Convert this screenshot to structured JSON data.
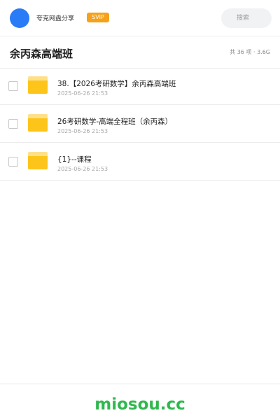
{
  "header": {
    "share_name": "夸克网盘分享",
    "badge": "SVIP",
    "search_placeholder": "搜索",
    "avatar_color": "#2a7bf6",
    "badge_color": "#f5a11b"
  },
  "folder": {
    "title": "余丙森高端班",
    "summary": "共 36 项 · 3.6G"
  },
  "items": [
    {
      "name": "38.【2026考研数学】余丙森高端班",
      "date": "2025-06-26 21:53",
      "icon": "folder-icon"
    },
    {
      "name": "26考研数学-高端全程班（余丙森）",
      "date": "2025-06-26 21:53",
      "icon": "folder-icon"
    },
    {
      "name": "{1}--课程",
      "date": "2025-06-26 21:53",
      "icon": "folder-icon"
    }
  ],
  "footer": {
    "brand": "miosou.cc",
    "brand_color": "#2fb84d"
  }
}
